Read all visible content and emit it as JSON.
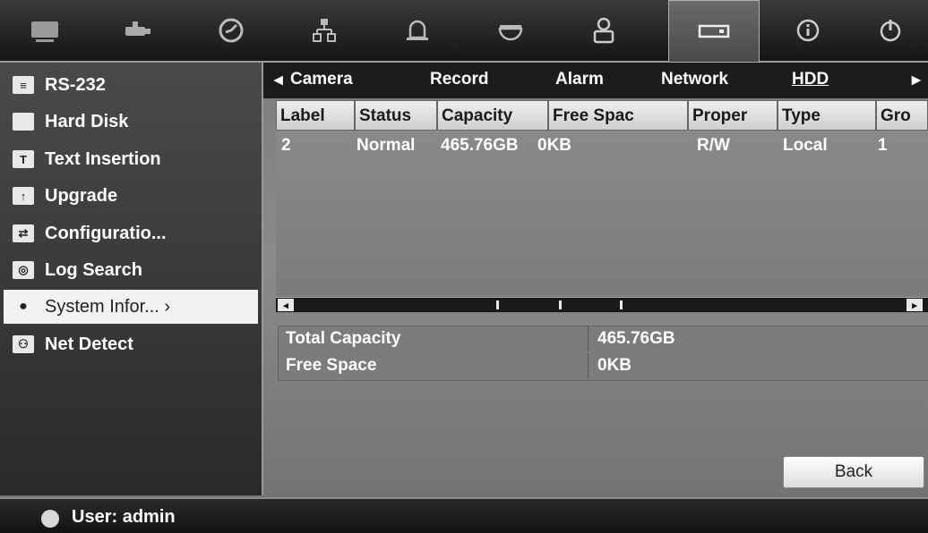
{
  "top_icons": [
    "display-icon",
    "camera-icon",
    "clock-icon",
    "network-icon",
    "bell-icon",
    "dome-camera-icon",
    "user-icon",
    "hdd-icon",
    "info-icon",
    "power-icon"
  ],
  "sidebar": {
    "items": [
      {
        "label": "RS-232",
        "icon": "rs232-icon"
      },
      {
        "label": "Hard Disk",
        "icon": "hard-disk-icon"
      },
      {
        "label": "Text Insertion",
        "icon": "text-insertion-icon"
      },
      {
        "label": "Upgrade",
        "icon": "upgrade-icon"
      },
      {
        "label": "Configuratio...",
        "icon": "configuration-icon"
      },
      {
        "label": "Log Search",
        "icon": "log-search-icon"
      },
      {
        "label": "System Infor... ›",
        "icon": "system-info-icon",
        "selected": true
      },
      {
        "label": "Net Detect",
        "icon": "net-detect-icon"
      }
    ]
  },
  "tabs": {
    "prev": "◂",
    "items": [
      "Camera",
      "Record",
      "Alarm",
      "Network",
      "HDD"
    ],
    "active": "HDD",
    "next": "▸"
  },
  "table": {
    "headers": [
      "Label",
      "Status",
      "Capacity",
      "Free Spac",
      "Proper",
      "Type",
      "Gro"
    ],
    "rows": [
      [
        "2",
        "Normal",
        "465.76GB",
        "0KB",
        "R/W",
        "Local",
        "1"
      ]
    ]
  },
  "summary": {
    "total_capacity_label": "Total Capacity",
    "total_capacity_value": "465.76GB",
    "free_space_label": "Free Space",
    "free_space_value": "0KB"
  },
  "back_label": "Back",
  "status": {
    "user_label": "User: admin"
  }
}
